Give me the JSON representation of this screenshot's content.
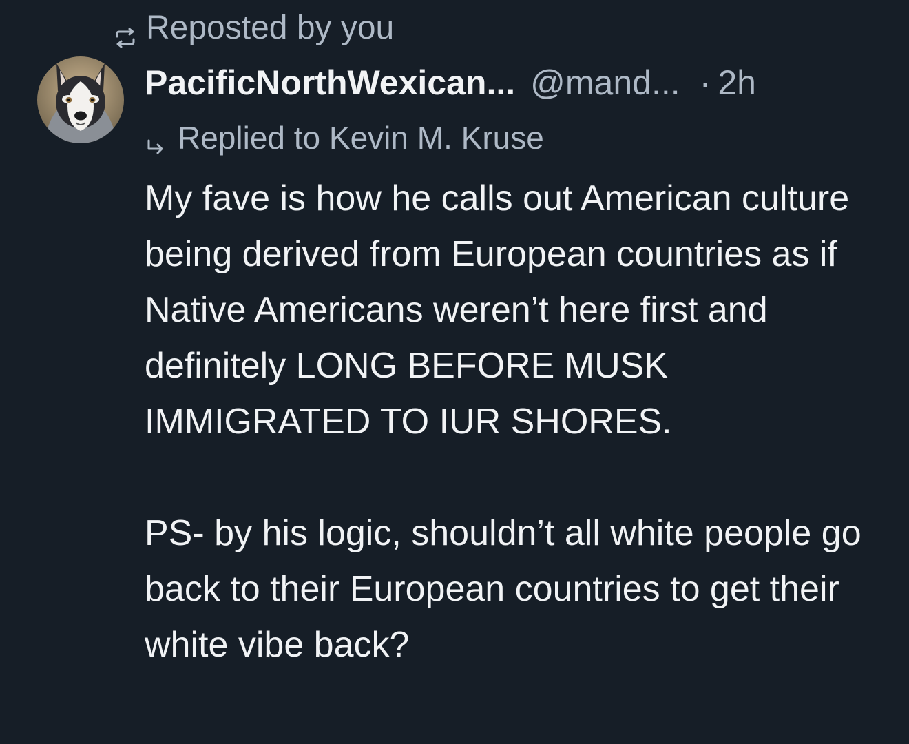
{
  "repost": {
    "icon": "repost-icon",
    "label": "Reposted by you"
  },
  "post": {
    "avatar": "husky-avatar",
    "display_name": "PacificNorthWexican...",
    "handle": "@mand...",
    "separator": "·",
    "time": "2h",
    "reply": {
      "icon": "reply-arrow-icon",
      "label": "Replied to Kevin M. Kruse"
    },
    "paragraphs": [
      "My fave is how he calls out American culture being derived from European countries as if Native Americans weren’t here first and definitely LONG BEFORE MUSK IMMIGRATED TO IUR SHORES.",
      "PS- by his logic, shouldn’t all white people go back to their European countries to get their white vibe back?"
    ]
  },
  "colors": {
    "background": "#161e27",
    "text_primary": "#f1f3f5",
    "text_secondary": "#aeb9c6"
  }
}
